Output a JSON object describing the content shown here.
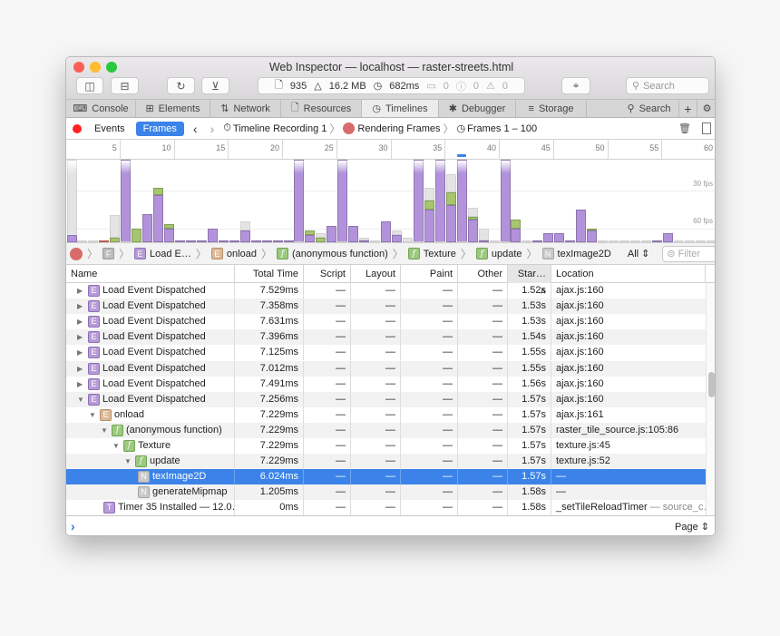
{
  "window": {
    "title": "Web Inspector — localhost — raster-streets.html"
  },
  "toolbar": {
    "resources_count": "935",
    "memory": "16.2 MB",
    "load_time": "682ms",
    "logs": "0",
    "errors": "0",
    "warnings": "0",
    "search_placeholder": "Search"
  },
  "tabs": [
    {
      "label": "Console",
      "icon": "console-icon"
    },
    {
      "label": "Elements",
      "icon": "elements-icon"
    },
    {
      "label": "Network",
      "icon": "network-icon"
    },
    {
      "label": "Resources",
      "icon": "document-icon"
    },
    {
      "label": "Timelines",
      "icon": "clock-icon",
      "selected": true
    },
    {
      "label": "Debugger",
      "icon": "bug-icon"
    },
    {
      "label": "Storage",
      "icon": "database-icon"
    },
    {
      "label": "Search",
      "icon": "search-icon"
    }
  ],
  "nav": {
    "events": "Events",
    "frames": "Frames",
    "recording": "Timeline Recording 1",
    "rendering": "Rendering Frames",
    "range": "Frames 1 – 100"
  },
  "ruler": {
    "ticks": [
      "5",
      "10",
      "15",
      "20",
      "25",
      "30",
      "35",
      "40",
      "45",
      "50",
      "55",
      "60"
    ],
    "current_frame": 37
  },
  "chart_labels": {
    "fps30": "30 fps",
    "fps60": "60 fps"
  },
  "colors": {
    "script": "#b293db",
    "layout": "#e3766d",
    "paint": "#a5c66f",
    "other": "#e4e4e4",
    "selection": "#3b83e8"
  },
  "chart_data": {
    "type": "bar",
    "stacked": true,
    "unit": "ms",
    "categories": "frames 1-60",
    "series_order": [
      "layout",
      "script",
      "paint",
      "other"
    ],
    "frames": [
      {
        "script": 3.5,
        "other": 45
      },
      {
        "other": 1
      },
      {
        "other": 1
      },
      {
        "layout": 1
      },
      {
        "paint": 2.3,
        "other": 11.5
      },
      {
        "script": 45
      },
      {
        "paint": 7
      },
      {
        "script": 14
      },
      {
        "script": 23.5,
        "paint": 3.7
      },
      {
        "script": 7,
        "paint": 2.3
      },
      {
        "script": 1
      },
      {
        "script": 1
      },
      {
        "script": 1
      },
      {
        "script": 7
      },
      {
        "script": 1
      },
      {
        "script": 1
      },
      {
        "script": 5.7,
        "other": 4.8
      },
      {
        "script": 1
      },
      {
        "script": 1
      },
      {
        "script": 1
      },
      {
        "script": 1
      },
      {
        "script": 45
      },
      {
        "script": 3.5,
        "paint": 2.3
      },
      {
        "paint": 2.3,
        "other": 2.3
      },
      {
        "script": 8
      },
      {
        "script": 45
      },
      {
        "script": 8
      },
      {
        "script": 1,
        "other": 1.2
      },
      {
        "other": 1
      },
      {
        "script": 10.5
      },
      {
        "script": 3.5,
        "other": 2.3
      },
      {
        "other": 2.3
      },
      {
        "script": 45
      },
      {
        "script": 16.5,
        "paint": 4.6,
        "other": 6.1
      },
      {
        "script": 45
      },
      {
        "script": 18.8,
        "paint": 6.1,
        "other": 9.2
      },
      {
        "script": 45
      },
      {
        "script": 11.5,
        "paint": 1.2,
        "other": 4.8
      },
      {
        "script": 1,
        "other": 6
      },
      {
        "other": 1
      },
      {
        "script": 45
      },
      {
        "script": 7,
        "paint": 4.6
      },
      {
        "other": 1
      },
      {
        "script": 1
      },
      {
        "script": 4.6
      },
      {
        "script": 4.6
      },
      {
        "script": 1
      },
      {
        "script": 16.5
      },
      {
        "script": 5.8,
        "paint": 1
      },
      {
        "other": 1
      },
      {
        "other": 1
      },
      {
        "other": 1
      },
      {
        "other": 1
      },
      {
        "other": 1
      },
      {
        "script": 1
      },
      {
        "script": 4.6
      },
      {
        "other": 1
      },
      {
        "other": 1
      },
      {
        "other": 1
      },
      {
        "other": 1
      }
    ]
  },
  "breadcrumbs": [
    {
      "icon": "F",
      "label": ""
    },
    {
      "icon": "E",
      "label": "Load E…"
    },
    {
      "icon": "O",
      "letter": "E",
      "label": "onload"
    },
    {
      "icon": "f",
      "label": "(anonymous function)"
    },
    {
      "icon": "f",
      "label": "Texture"
    },
    {
      "icon": "f",
      "label": "update"
    },
    {
      "icon": "N",
      "label": "texImage2D"
    }
  ],
  "filter": {
    "scope": "All",
    "placeholder": "Filter"
  },
  "columns": [
    "Name",
    "Total Time",
    "Script",
    "Layout",
    "Paint",
    "Other",
    "Star…",
    "Location"
  ],
  "rows": [
    {
      "level": 0,
      "exp": false,
      "icon": "E",
      "name": "Load Event Dispatched",
      "total": "7.529ms",
      "script": "—",
      "layout": "—",
      "paint": "—",
      "other": "—",
      "start": "1.52s",
      "loc": "ajax.js:160"
    },
    {
      "level": 0,
      "exp": false,
      "icon": "E",
      "name": "Load Event Dispatched",
      "total": "7.358ms",
      "script": "—",
      "layout": "—",
      "paint": "—",
      "other": "—",
      "start": "1.53s",
      "loc": "ajax.js:160"
    },
    {
      "level": 0,
      "exp": false,
      "icon": "E",
      "name": "Load Event Dispatched",
      "total": "7.631ms",
      "script": "—",
      "layout": "—",
      "paint": "—",
      "other": "—",
      "start": "1.53s",
      "loc": "ajax.js:160"
    },
    {
      "level": 0,
      "exp": false,
      "icon": "E",
      "name": "Load Event Dispatched",
      "total": "7.396ms",
      "script": "—",
      "layout": "—",
      "paint": "—",
      "other": "—",
      "start": "1.54s",
      "loc": "ajax.js:160"
    },
    {
      "level": 0,
      "exp": false,
      "icon": "E",
      "name": "Load Event Dispatched",
      "total": "7.125ms",
      "script": "—",
      "layout": "—",
      "paint": "—",
      "other": "—",
      "start": "1.55s",
      "loc": "ajax.js:160"
    },
    {
      "level": 0,
      "exp": false,
      "icon": "E",
      "name": "Load Event Dispatched",
      "total": "7.012ms",
      "script": "—",
      "layout": "—",
      "paint": "—",
      "other": "—",
      "start": "1.55s",
      "loc": "ajax.js:160"
    },
    {
      "level": 0,
      "exp": false,
      "icon": "E",
      "name": "Load Event Dispatched",
      "total": "7.491ms",
      "script": "—",
      "layout": "—",
      "paint": "—",
      "other": "—",
      "start": "1.56s",
      "loc": "ajax.js:160"
    },
    {
      "level": 0,
      "exp": true,
      "icon": "E",
      "name": "Load Event Dispatched",
      "total": "7.256ms",
      "script": "—",
      "layout": "—",
      "paint": "—",
      "other": "—",
      "start": "1.57s",
      "loc": "ajax.js:160"
    },
    {
      "level": 1,
      "exp": true,
      "icon": "O",
      "letter": "E",
      "name": "onload",
      "total": "7.229ms",
      "script": "—",
      "layout": "—",
      "paint": "—",
      "other": "—",
      "start": "1.57s",
      "loc": "ajax.js:161"
    },
    {
      "level": 2,
      "exp": true,
      "icon": "f",
      "name": "(anonymous function)",
      "total": "7.229ms",
      "script": "—",
      "layout": "—",
      "paint": "—",
      "other": "—",
      "start": "1.57s",
      "loc": "raster_tile_source.js:105:86"
    },
    {
      "level": 3,
      "exp": true,
      "icon": "f",
      "name": "Texture",
      "total": "7.229ms",
      "script": "—",
      "layout": "—",
      "paint": "—",
      "other": "—",
      "start": "1.57s",
      "loc": "texture.js:45"
    },
    {
      "level": 4,
      "exp": true,
      "icon": "f",
      "name": "update",
      "total": "7.229ms",
      "script": "—",
      "layout": "—",
      "paint": "—",
      "other": "—",
      "start": "1.57s",
      "loc": "texture.js:52"
    },
    {
      "level": 5,
      "exp": null,
      "icon": "N",
      "name": "texImage2D",
      "total": "6.024ms",
      "script": "—",
      "layout": "—",
      "paint": "—",
      "other": "—",
      "start": "1.57s",
      "loc": "—",
      "selected": true
    },
    {
      "level": 5,
      "exp": null,
      "icon": "N",
      "name": "generateMipmap",
      "total": "1.205ms",
      "script": "—",
      "layout": "—",
      "paint": "—",
      "other": "—",
      "start": "1.58s",
      "loc": "—"
    },
    {
      "level": 2,
      "exp": null,
      "icon": "T",
      "name": "Timer 35 Installed — 12.0…",
      "total": "0ms",
      "script": "—",
      "layout": "—",
      "paint": "—",
      "other": "—",
      "start": "1.58s",
      "loc": "_setTileReloadTimer",
      "loc_suffix": " — source_c…"
    }
  ],
  "console": {
    "prompt": "›",
    "scope": "Page"
  }
}
